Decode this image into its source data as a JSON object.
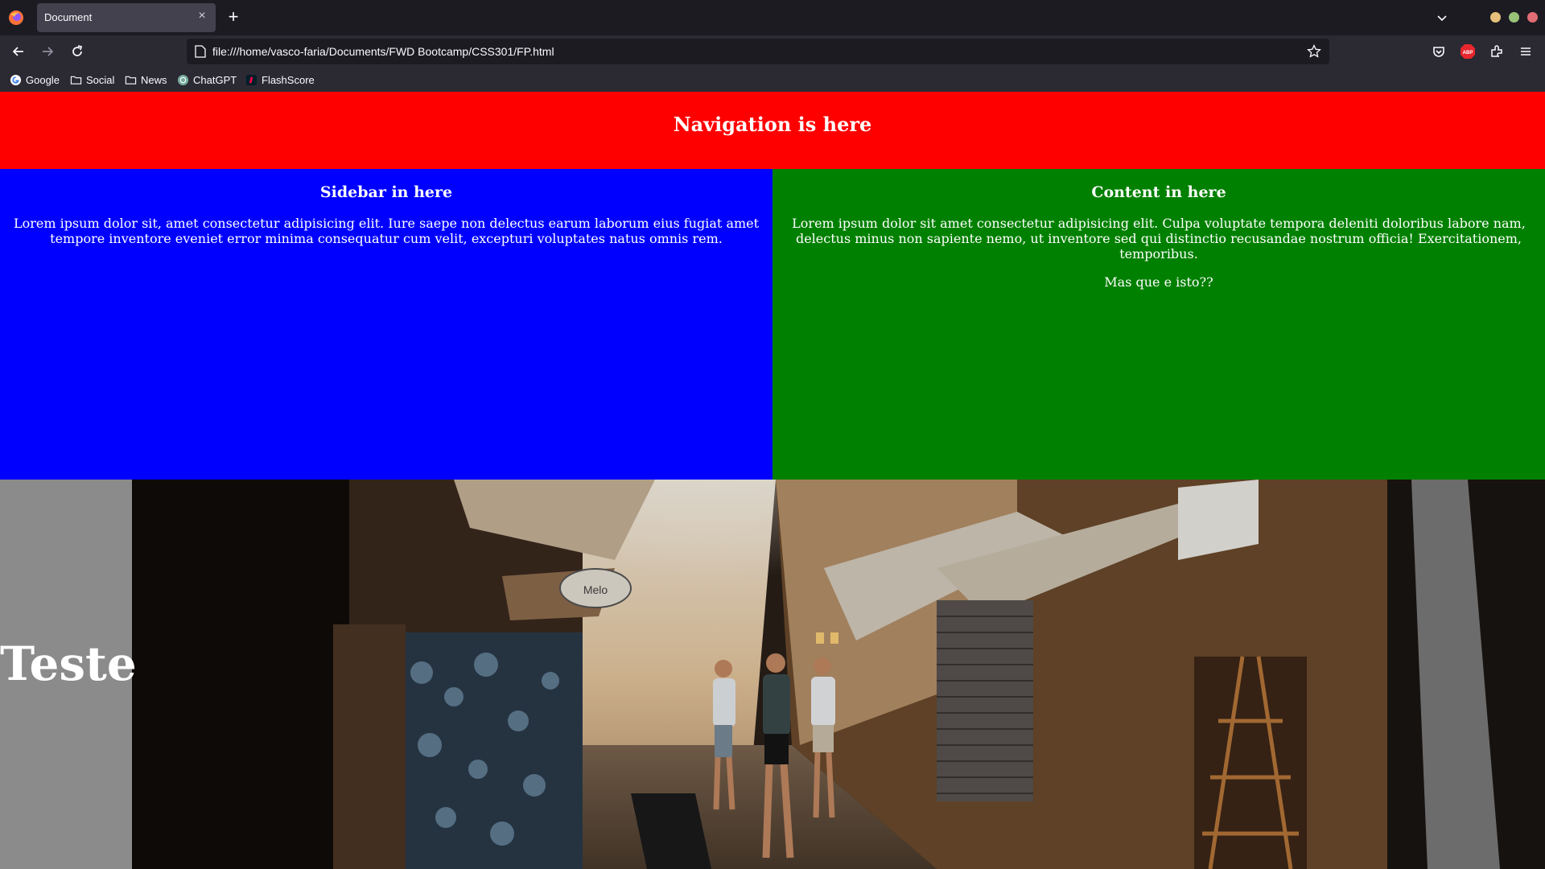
{
  "browser": {
    "tab_title": "Document",
    "tab_close": "×",
    "new_tab": "+",
    "url": "file:///home/vasco-faria/Documents/FWD Bootcamp/CSS301/FP.html",
    "bookmarks": [
      {
        "label": "Google",
        "icon": "google-icon"
      },
      {
        "label": "Social",
        "icon": "folder-icon"
      },
      {
        "label": "News",
        "icon": "folder-icon"
      },
      {
        "label": "ChatGPT",
        "icon": "chatgpt-icon"
      },
      {
        "label": "FlashScore",
        "icon": "flashscore-icon"
      }
    ]
  },
  "page": {
    "nav_title": "Navigation is here",
    "sidebar": {
      "title": "Sidebar in here",
      "text": "Lorem ipsum dolor sit, amet consectetur adipisicing elit. Iure saepe non delectus earum laborum eius fugiat amet tempore inventore eveniet error minima consequatur cum velit, excepturi voluptates natus omnis rem."
    },
    "content": {
      "title": "Content in here",
      "text": "Lorem ipsum dolor sit amet consectetur adipisicing elit. Culpa voluptate tempora deleniti doloribus labore nam, delectus minus non sapiente nemo, ut inventore sed qui distinctio recusandae nostrum officia! Exercitationem, temporibus.",
      "extra": "Mas que e isto??"
    },
    "hero_title": "Teste",
    "hero_sign": "Melo"
  },
  "colors": {
    "nav": "#ff0000",
    "sidebar": "#0000ff",
    "content": "#008000",
    "hero_side": "#8b8b8b"
  }
}
